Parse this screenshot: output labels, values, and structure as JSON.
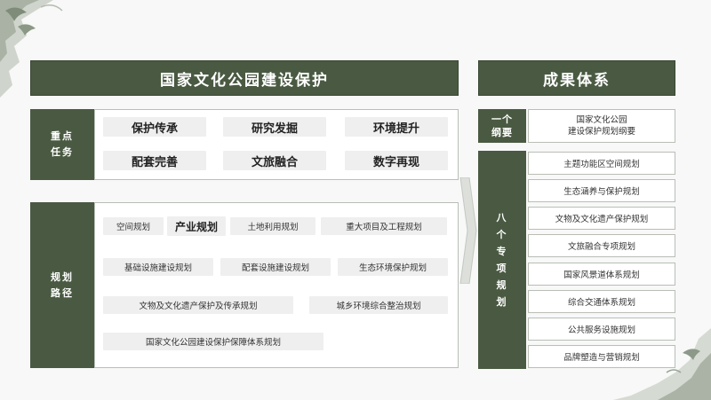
{
  "left_title": "国家文化公园建设保护",
  "right_title": "成果体系",
  "key_tasks": {
    "label": "重点\n任务",
    "items": [
      "保护传承",
      "研究发掘",
      "环境提升",
      "配套完善",
      "文旅融合",
      "数字再现"
    ]
  },
  "planning_paths": {
    "label": "规划\n路径",
    "items": [
      "空间规划",
      "产业规划",
      "土地利用规划",
      "重大项目及工程规划",
      "基础设施建设规划",
      "配套设施建设规划",
      "生态环境保护规划",
      "文物及文化遗产保护及传承规划",
      "城乡环境综合整治规划",
      "国家文化公园建设保护保障体系规划"
    ]
  },
  "outline": {
    "label": "一个\n纲要",
    "text": "国家文化公园\n建设保护规划纲要"
  },
  "special_plans": {
    "label": "八\n个\n专\n项\n规\n划",
    "items": [
      "主题功能区空间规划",
      "生态涵养与保护规划",
      "文物及文化遗产保护规划",
      "文旅融合专项规划",
      "国家风景道体系规划",
      "综合交通体系规划",
      "公共服务设施规划",
      "品牌塑造与营销规划"
    ]
  },
  "colors": {
    "primary": "#4a5a42",
    "chip": "#efefef",
    "border": "#b9beb6"
  }
}
